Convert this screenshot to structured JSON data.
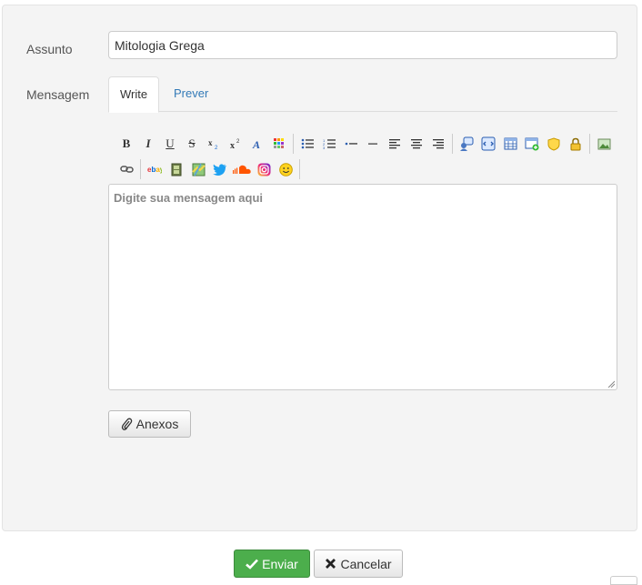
{
  "form": {
    "subject_label": "Assunto",
    "subject_value": "Mitologia Grega",
    "message_label": "Mensagem",
    "tabs": [
      {
        "label": "Write",
        "active": true
      },
      {
        "label": "Prever",
        "active": false
      }
    ],
    "message_placeholder": "Digite sua mensagem aqui",
    "message_value": "",
    "attach_label": "Anexos",
    "send_label": "Enviar",
    "cancel_label": "Cancelar"
  },
  "toolbar": {
    "bold": "B",
    "italic": "I",
    "underline": "U",
    "strike": "S"
  },
  "colors": {
    "panel_bg": "#f4f4f4",
    "link": "#337ab7",
    "send_bg": "#4cae4c"
  }
}
